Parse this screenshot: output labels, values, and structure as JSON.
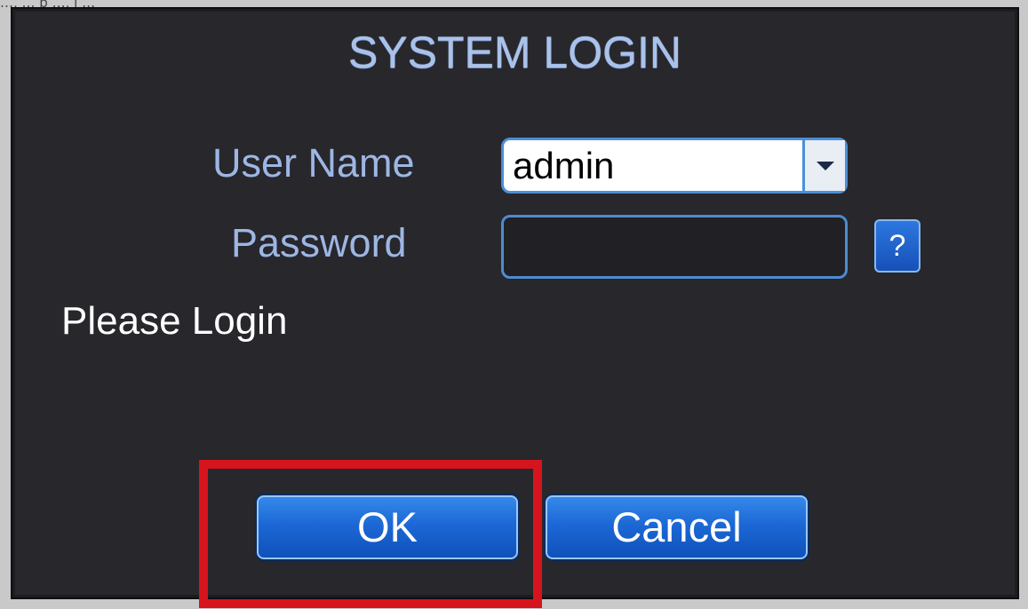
{
  "top_text": "…, … p …, j …",
  "dialog": {
    "title": "SYSTEM LOGIN",
    "user_label": "User Name",
    "user_value": "admin",
    "password_label": "Password",
    "password_value": "",
    "help_label": "?",
    "status_text": "Please Login",
    "ok_label": "OK",
    "cancel_label": "Cancel"
  },
  "icons": {
    "dropdown": "chevron-down-icon",
    "help": "question-icon"
  },
  "colors": {
    "dialog_bg": "#27272c",
    "accent_text": "#9db6e4",
    "button_blue": "#1c68d6",
    "field_border": "#4d8bd0",
    "highlight_red": "#d6141d"
  }
}
